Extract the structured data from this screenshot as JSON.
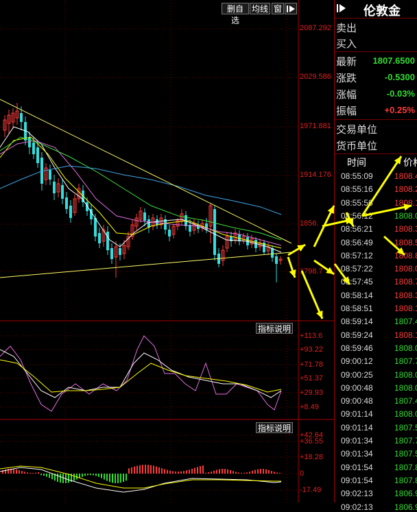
{
  "toolbar": {
    "delete_watch_label": "删自选",
    "ma_label": "均线",
    "window_label": "窗",
    "panel_title": "伦敦金"
  },
  "main_axis": {
    "labels": [
      "2087.292",
      "2029.586",
      "1971.881",
      "1914.176",
      "1856.",
      "1798.7"
    ]
  },
  "indicator1": {
    "button_label": "指标说明",
    "labels": [
      "+113.6",
      "+93.22",
      "+71.78",
      "+51.37",
      "+29.93",
      "+8.49"
    ]
  },
  "indicator2": {
    "button_label": "指标说明",
    "labels": [
      "+42.64",
      "+36.55",
      "+18.28",
      "0",
      "-17.49"
    ]
  },
  "quote": {
    "sell_label": "卖出",
    "buy_label": "买入",
    "latest_label": "最新",
    "latest_value": "1807.6500",
    "change_label": "涨跌",
    "change_value": "-0.5300",
    "change_pct_label": "涨幅",
    "change_pct_value": "-0.03%",
    "amplitude_label": "振幅",
    "amplitude_value": "+0.25%",
    "trade_unit_label": "交易单位",
    "currency_unit_label": "货币单位"
  },
  "ticks": {
    "time_header": "时间",
    "price_header": "价格",
    "rows": [
      {
        "time": "08:55:09",
        "price": "1808.4",
        "color": "#ff3b3b"
      },
      {
        "time": "08:55:16",
        "price": "1808.2",
        "color": "#ff3b3b"
      },
      {
        "time": "08:55:56",
        "price": "1808.1",
        "color": "#ff3b3b"
      },
      {
        "time": "08:56:12",
        "price": "1808.0",
        "color": "#33dd33"
      },
      {
        "time": "08:56:21",
        "price": "1808.3",
        "color": "#ff3b3b"
      },
      {
        "time": "08:56:49",
        "price": "1808.5",
        "color": "#ff3b3b"
      },
      {
        "time": "08:57:12",
        "price": "1808.8",
        "color": "#ff3b3b"
      },
      {
        "time": "08:57:22",
        "price": "1808.0",
        "color": "#ff3b3b"
      },
      {
        "time": "08:57:45",
        "price": "1808.7",
        "color": "#ff3b3b"
      },
      {
        "time": "08:58:14",
        "price": "1808.3",
        "color": "#ff3b3b"
      },
      {
        "time": "08:58:51",
        "price": "1808.1",
        "color": "#ff3b3b"
      },
      {
        "time": "08:59:14",
        "price": "1807.4",
        "color": "#33dd33"
      },
      {
        "time": "08:59:24",
        "price": "1808.1",
        "color": "#ff3b3b"
      },
      {
        "time": "08:59:46",
        "price": "1808.0",
        "color": "#33dd33"
      },
      {
        "time": "09:00:12",
        "price": "1807.7",
        "color": "#33dd33"
      },
      {
        "time": "09:00:25",
        "price": "1808.0",
        "color": "#33dd33"
      },
      {
        "time": "09:00:48",
        "price": "1808.0",
        "color": "#33dd33"
      },
      {
        "time": "09:00:48",
        "price": "1807.4",
        "color": "#33dd33"
      },
      {
        "time": "09:01:14",
        "price": "1808.0",
        "color": "#33dd33"
      },
      {
        "time": "09:01:14",
        "price": "1807.5",
        "color": "#33dd33"
      },
      {
        "time": "09:01:34",
        "price": "1807.7",
        "color": "#33dd33"
      },
      {
        "time": "09:01:34",
        "price": "1807.5",
        "color": "#33dd33"
      },
      {
        "time": "09:01:54",
        "price": "1807.8",
        "color": "#33dd33"
      },
      {
        "time": "09:01:54",
        "price": "1807.8",
        "color": "#33dd33"
      },
      {
        "time": "09:02:13",
        "price": "1806.9",
        "color": "#33dd33"
      },
      {
        "time": "09:02:13",
        "price": "1806.9",
        "color": "#33dd33"
      }
    ]
  },
  "colors": {
    "up": "#ff3b3b",
    "down": "#33dddd",
    "grid": "#6a0000",
    "trend": "#ffff66",
    "arrow": "#ffff00"
  }
}
